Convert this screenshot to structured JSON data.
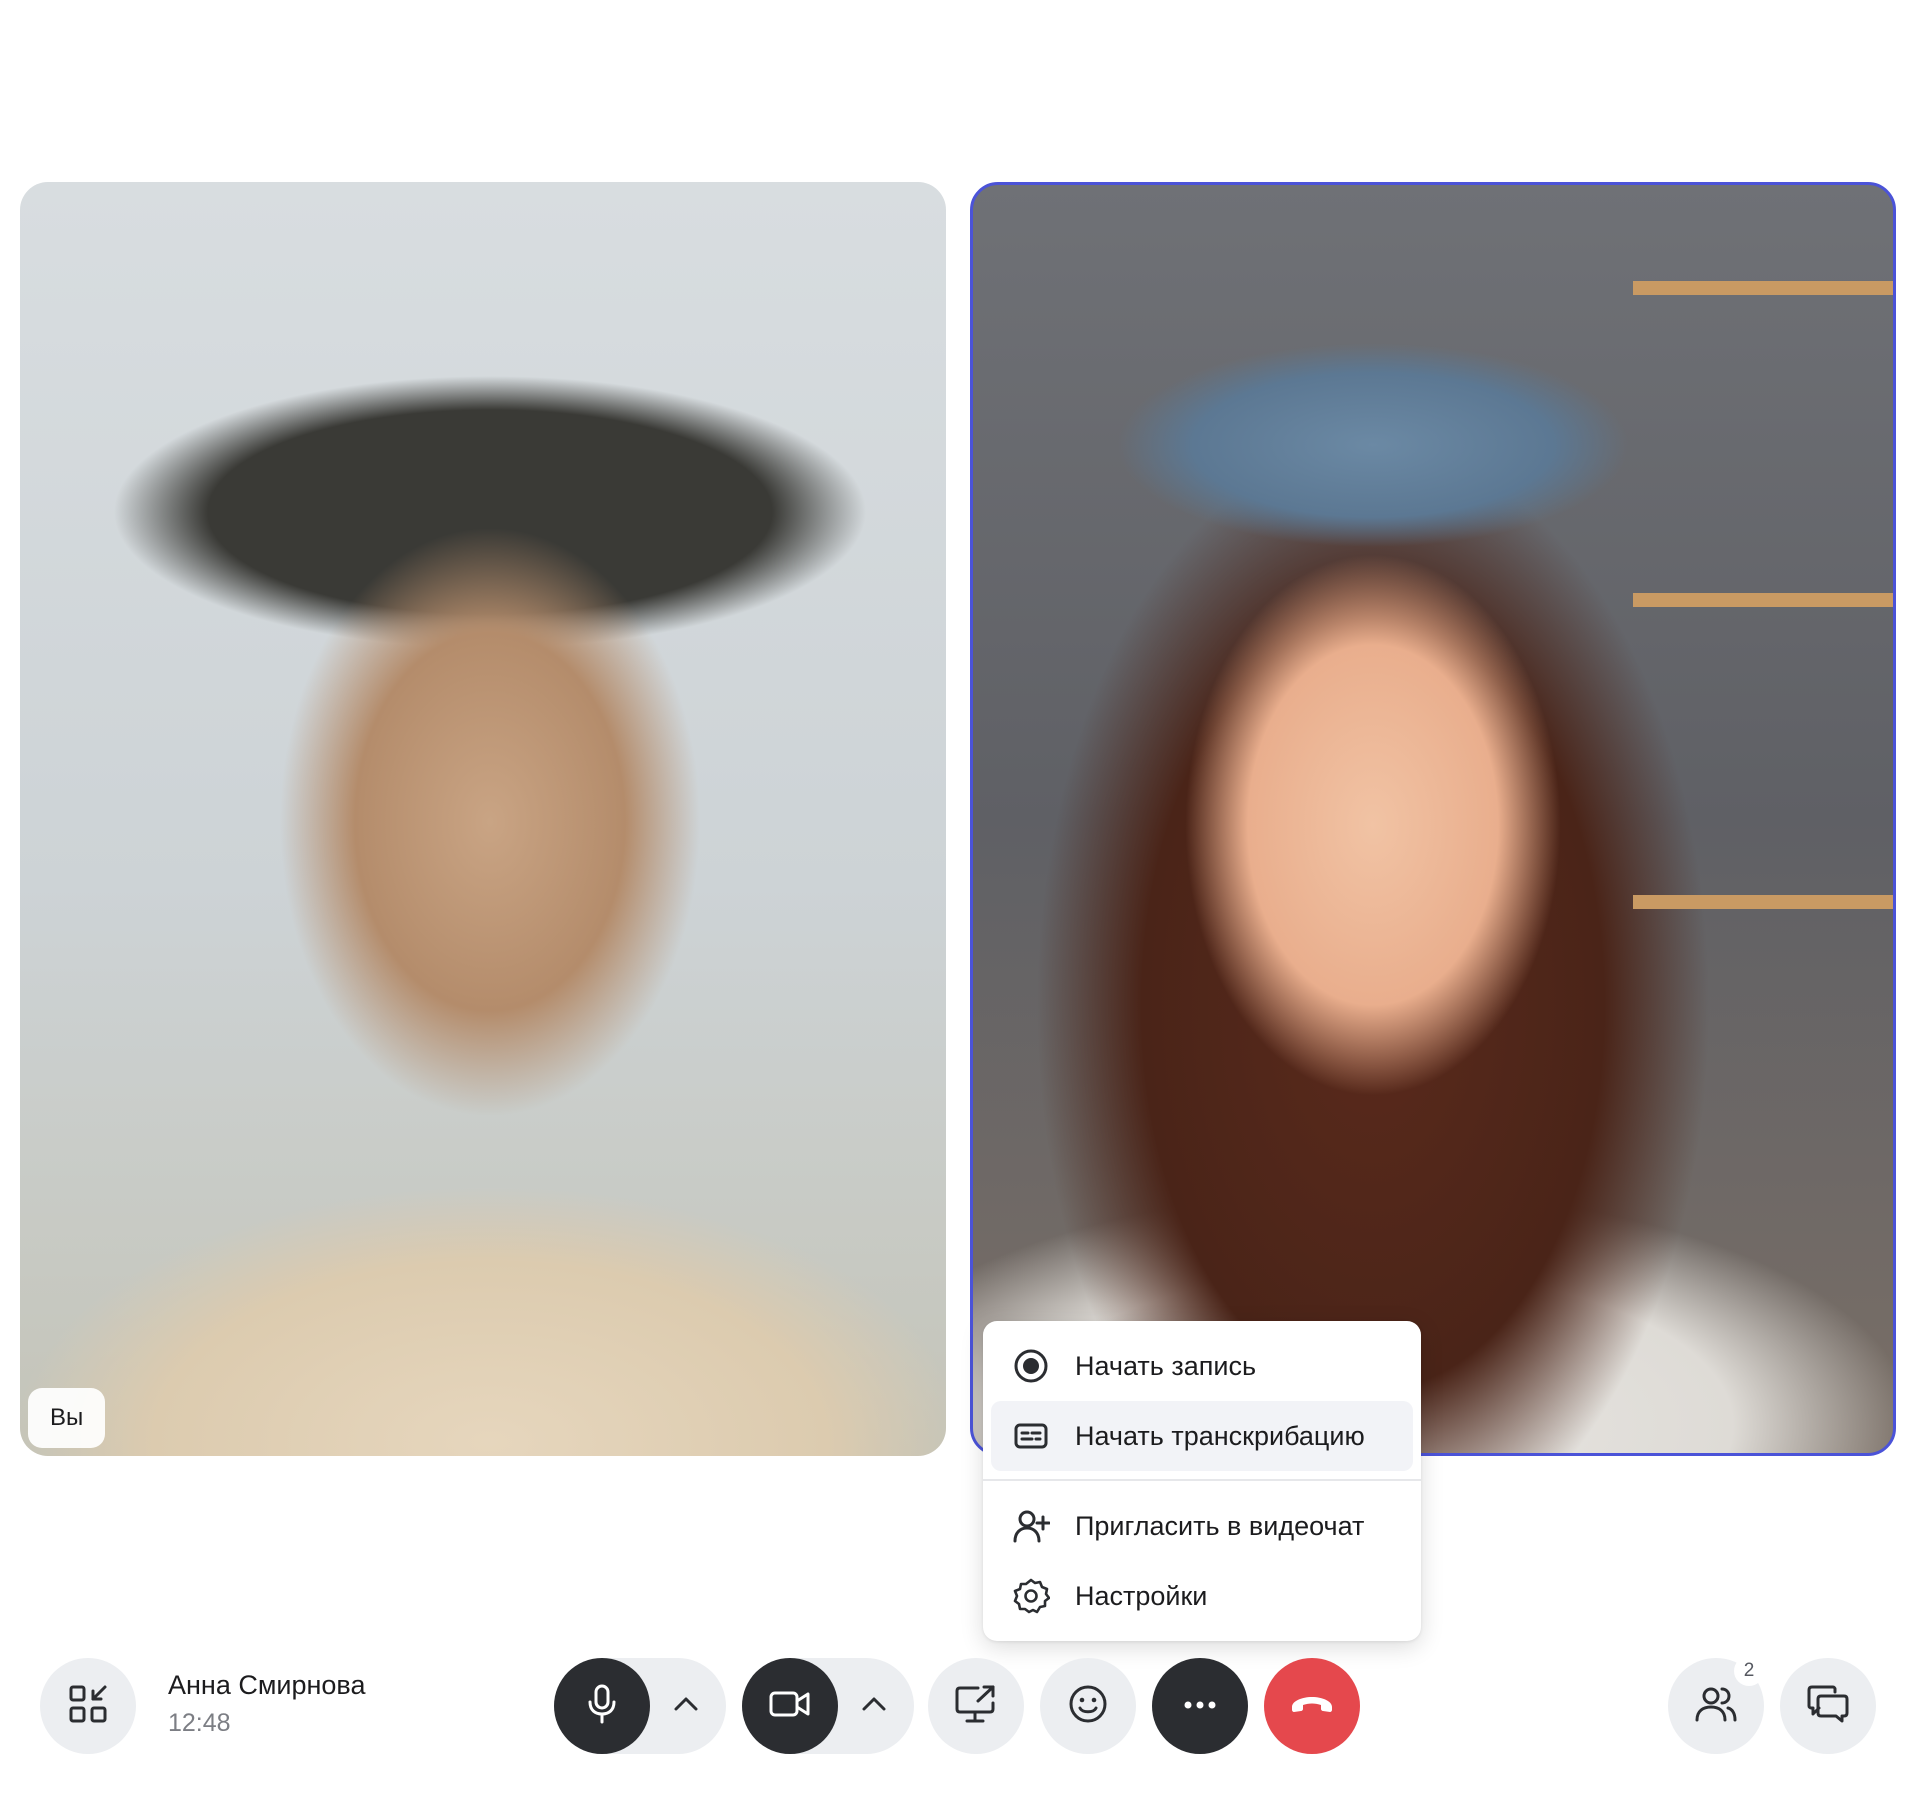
{
  "tiles": {
    "self_label": "Вы",
    "active_border_color": "#4b53d8"
  },
  "menu": {
    "items": [
      {
        "label": "Начать запись",
        "icon": "record-icon"
      },
      {
        "label": "Начать транскрибацию",
        "icon": "captions-icon"
      },
      {
        "label": "Пригласить в видеочат",
        "icon": "add-user-icon"
      },
      {
        "label": "Настройки",
        "icon": "gear-icon"
      }
    ]
  },
  "call": {
    "name": "Анна Смирнова",
    "time": "12:48",
    "participants_count": "2"
  },
  "toolbar": {
    "buttons": [
      "minimize-icon",
      "microphone-icon",
      "chevron-up-icon",
      "camera-icon",
      "chevron-up-icon",
      "screen-share-icon",
      "emoji-icon",
      "more-icon",
      "hang-up-icon",
      "participants-icon",
      "chat-icon"
    ],
    "hangup_color": "#e5484d"
  }
}
